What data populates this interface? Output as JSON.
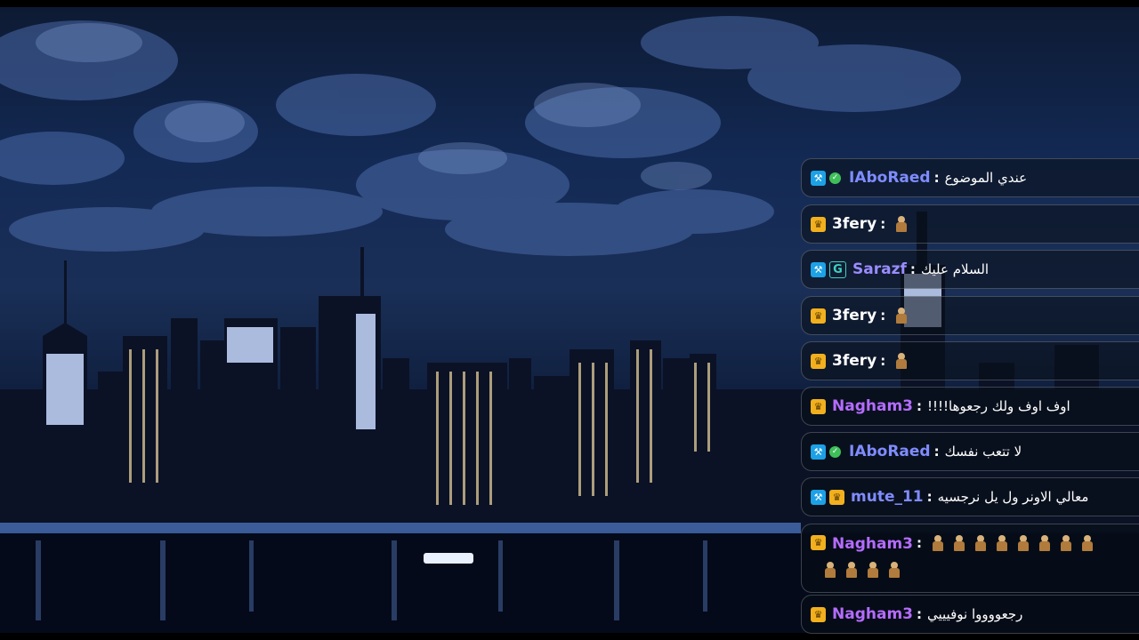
{
  "colors": {
    "mod_blue": "#1da1e6",
    "crown_gold": "#f2b01e",
    "verified_green": "#3fbf5a",
    "user_purple": "#8a7bff",
    "user_violet": "#b46cff",
    "user_blue": "#7f8cff"
  },
  "chat": {
    "messages": [
      {
        "badges": [
          "mod-icon",
          "verified-icon"
        ],
        "user": "IAboRaed",
        "user_color": "#7f8cff",
        "sep": ":",
        "text": "عندي الموضوع"
      },
      {
        "badges": [
          "crown-icon"
        ],
        "user": "3fery",
        "user_color": "#ffffff",
        "sep": ":",
        "text": "",
        "emotes": 1
      },
      {
        "badges": [
          "mod-icon",
          "og-icon"
        ],
        "user": "Sarazf",
        "user_color": "#9a8cff",
        "sep": ":",
        "text": "السلام عليك"
      },
      {
        "badges": [
          "crown-icon"
        ],
        "user": "3fery",
        "user_color": "#ffffff",
        "sep": ":",
        "text": "",
        "emotes": 1
      },
      {
        "badges": [
          "crown-icon"
        ],
        "user": "3fery",
        "user_color": "#ffffff",
        "sep": ":",
        "text": "",
        "emotes": 1
      },
      {
        "badges": [
          "crown-icon"
        ],
        "user": "Nagham3",
        "user_color": "#b46cff",
        "sep": ":",
        "text": "اوف اوف ولك رجعوها!!!!"
      },
      {
        "badges": [
          "mod-icon",
          "verified-icon"
        ],
        "user": "IAboRaed",
        "user_color": "#7f8cff",
        "sep": ":",
        "text": "لا تتعب نفسك"
      },
      {
        "badges": [
          "mod-icon",
          "crown-icon"
        ],
        "user": "mute_11",
        "user_color": "#7f8cff",
        "sep": ":",
        "text": "معالي الاونر ول يل نرجسيه"
      },
      {
        "badges": [
          "crown-icon"
        ],
        "user": "Nagham3",
        "user_color": "#b46cff",
        "sep": ":",
        "text": "",
        "emotes": 12
      },
      {
        "badges": [
          "crown-icon"
        ],
        "user": "Nagham3",
        "user_color": "#b46cff",
        "sep": ":",
        "text": "رجعووووا نوفيييي"
      }
    ]
  }
}
